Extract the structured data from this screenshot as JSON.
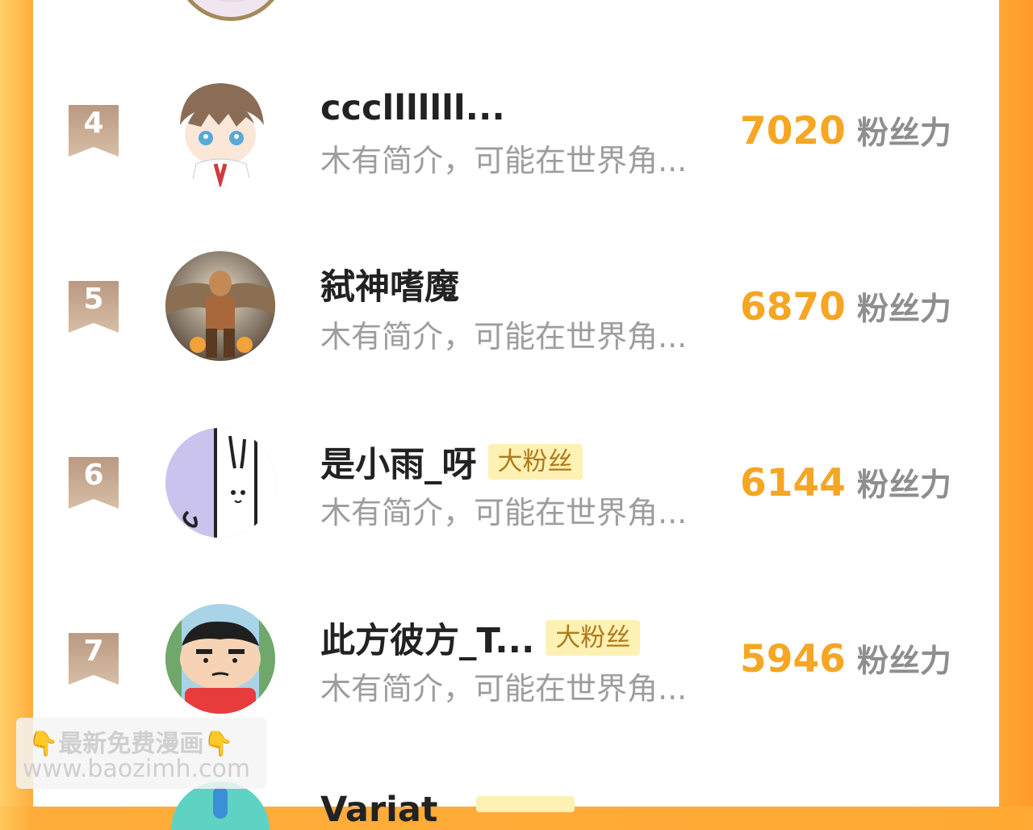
{
  "rows": [
    {
      "rank": "4",
      "name": "ccclllllll...",
      "badge": "",
      "bio": "木有简介，可能在世界角...",
      "score": "7020",
      "unit": "粉丝力"
    },
    {
      "rank": "5",
      "name": "弑神嗜魔",
      "badge": "",
      "bio": "木有简介，可能在世界角...",
      "score": "6870",
      "unit": "粉丝力"
    },
    {
      "rank": "6",
      "name": "是小雨_呀",
      "badge": "大粉丝",
      "bio": "木有简介，可能在世界角...",
      "score": "6144",
      "unit": "粉丝力"
    },
    {
      "rank": "7",
      "name": "此方彼方_T...",
      "badge": "大粉丝",
      "bio": "木有简介，可能在世界角...",
      "score": "5946",
      "unit": "粉丝力"
    }
  ],
  "partial_row": {
    "name": "Variat"
  },
  "watermark": {
    "line1": "最新免费漫画",
    "line2": "www.baozimh.com",
    "pointer": "👇"
  },
  "colors": {
    "accent": "#f5a623",
    "rank_ribbon": "#c9a98a",
    "badge_bg": "#fdf1b3"
  }
}
